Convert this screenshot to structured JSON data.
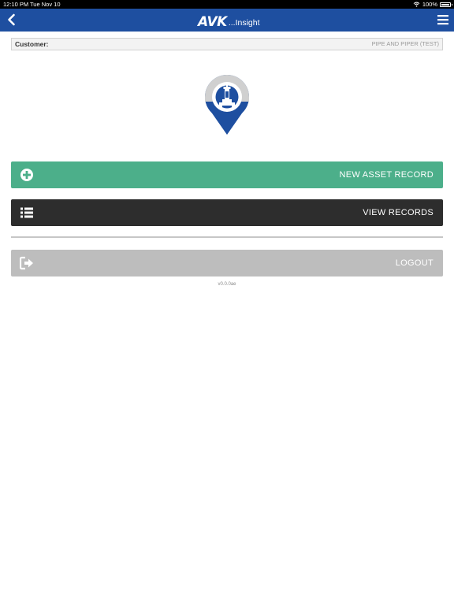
{
  "status_bar": {
    "time": "12:10 PM",
    "date": "Tue Nov 10",
    "battery": "100%"
  },
  "header": {
    "logo_text": "AVK",
    "app_title": "...Insight"
  },
  "customer": {
    "label": "Customer:",
    "value": "PIPE AND PIPER (TEST)"
  },
  "buttons": {
    "new_asset": "NEW ASSET RECORD",
    "view_records": "VIEW RECORDS",
    "logout": "LOGOUT"
  },
  "version": "v0.0.0ae",
  "colors": {
    "header_blue": "#1e4fa0",
    "new_asset_green": "#4caf8a",
    "view_dark": "#2d2d2d",
    "logout_gray": "#bdbdbd"
  },
  "icons": {
    "back": "chevron-left-icon",
    "menu": "hamburger-menu-icon",
    "new_asset": "plus-circle-icon",
    "view_records": "list-icon",
    "logout": "sign-out-icon",
    "logo": "location-pin-valve-icon"
  }
}
